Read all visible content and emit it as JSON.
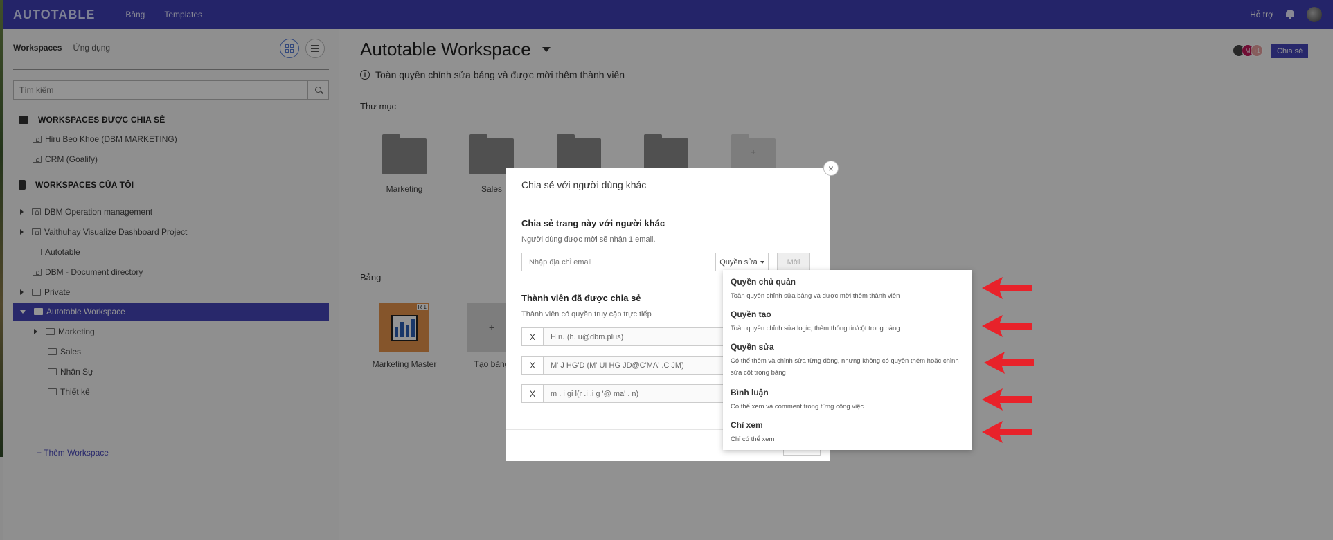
{
  "topbar": {
    "logo": "AUTOTABLE",
    "nav": [
      "Bảng",
      "Templates"
    ],
    "support": "Hỗ trợ"
  },
  "sidebar": {
    "tabs": [
      "Workspaces",
      "Ứng dụng"
    ],
    "search_placeholder": "Tìm kiếm",
    "shared_header": "WORKSPACES ĐƯỢC CHIA SẺ",
    "shared_items": [
      "Hiru Beo Khoe (DBM MARKETING)",
      "CRM (Goalify)"
    ],
    "mine_header": "WORKSPACES CỦA TÔI",
    "my_items": [
      "DBM Operation management",
      "Vaithuhay Visualize Dashboard Project",
      "Autotable",
      "DBM - Document directory",
      "Private",
      "Autotable Workspace"
    ],
    "sub_items": [
      "Marketing",
      "Sales",
      "Nhân Sự",
      "Thiết kế"
    ],
    "add_workspace": "+ Thêm Workspace"
  },
  "main": {
    "title": "Autotable Workspace",
    "description": "Toàn quyền chỉnh sửa bảng và được mời thêm thành viên",
    "folders_label": "Thư mục",
    "folders": [
      "Marketing",
      "Sales"
    ],
    "new_folder_symbol": "+",
    "boards_label": "Bảng",
    "boards": [
      {
        "name": "Marketing Master",
        "badge": "R 1"
      },
      {
        "name": "Tạo bảng",
        "symbol": "+"
      }
    ],
    "avatar_initials": "M",
    "avatar_more": "+1",
    "share_button": "Chia sẻ"
  },
  "modal": {
    "title": "Chia sẻ với người dùng khác",
    "close_symbol": "×",
    "share_title": "Chia sẻ trang này với người khác",
    "share_sub": "Người dùng được mời sẽ nhận 1 email.",
    "email_placeholder": "Nhập địa chỉ email",
    "role_selected": "Quyền sửa",
    "invite_label": "Mời",
    "members_title": "Thành viên đã được chia sẻ",
    "members_sub": "Thành viên có quyền truy cập trực tiếp",
    "remove_symbol": "X",
    "members": [
      "H ru (h. u@dbm.plus)",
      "M' J HG'D (M' UI HG JD@C'MA' .C JM)",
      "m . i gi l(r .i .i g '@ ma' . n)"
    ]
  },
  "dropdown": {
    "options": [
      {
        "title": "Quyền chủ quản",
        "desc": "Toàn quyền chỉnh sửa bảng và được mời thêm thành viên"
      },
      {
        "title": "Quyền tạo",
        "desc": "Toàn quyền chỉnh sửa logic, thêm thông tin/cột trong bảng"
      },
      {
        "title": "Quyền sửa",
        "desc": "Có thể thêm và chỉnh sửa từng dòng, nhưng không có quyền thêm hoặc chỉnh sửa cột trong bảng"
      },
      {
        "title": "Bình luận",
        "desc": "Có thể xem và comment trong từng công việc"
      },
      {
        "title": "Chỉ xem",
        "desc": "Chỉ có thể xem"
      }
    ]
  },
  "colors": {
    "brand": "#3f3fb6",
    "selected": "#4545b8",
    "arrow": "#e8222a"
  }
}
